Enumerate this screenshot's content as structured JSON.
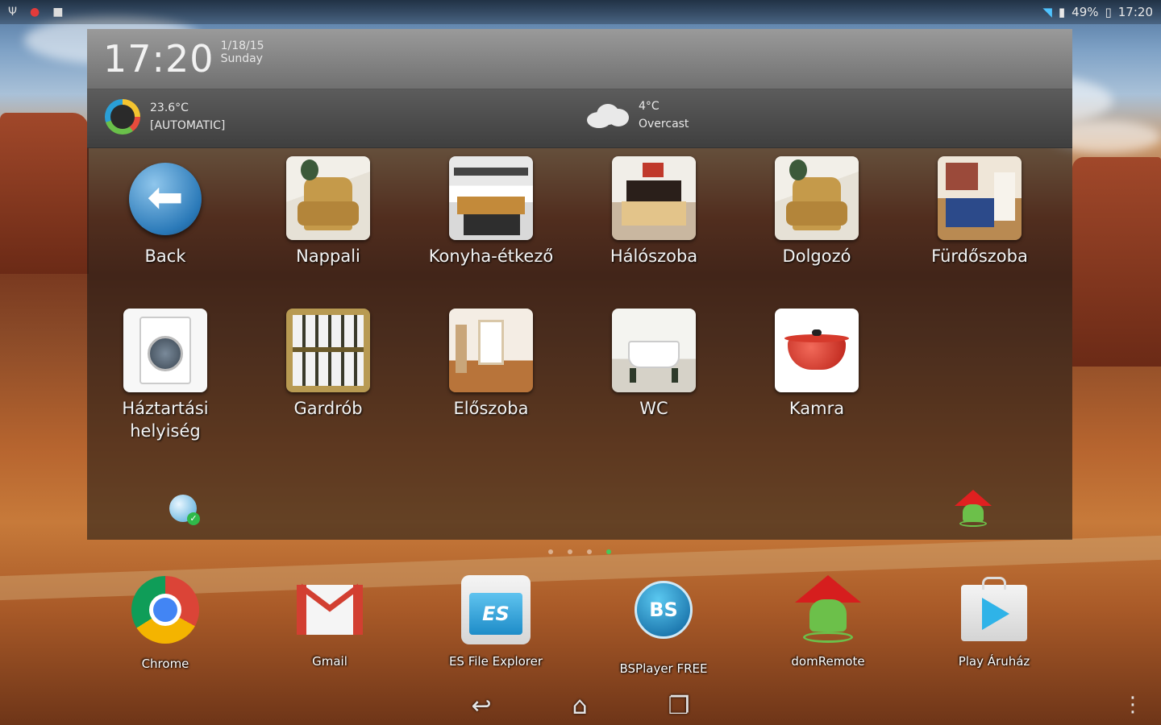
{
  "status_bar": {
    "left_icons": [
      "usb-icon",
      "notification-icon",
      "media-icon"
    ],
    "battery": "49%",
    "time": "17:20"
  },
  "widget": {
    "clock": "17:20",
    "date": "1/18/15",
    "day": "Sunday",
    "thermostat": {
      "temperature": "23.6°C",
      "mode": "[AUTOMATIC]"
    },
    "weather": {
      "temperature": "4°C",
      "condition": "Overcast"
    }
  },
  "rooms": [
    {
      "label": "Back",
      "icon": "back-arrow-icon"
    },
    {
      "label": "Nappali",
      "icon": "armchair-icon"
    },
    {
      "label": "Konyha-étkező",
      "icon": "kitchen-icon"
    },
    {
      "label": "Hálószoba",
      "icon": "bedroom-icon"
    },
    {
      "label": "Dolgozó",
      "icon": "armchair-icon"
    },
    {
      "label": "Fürdőszoba",
      "icon": "bathroom-icon"
    },
    {
      "label": "Háztartási helyiség",
      "icon": "washing-machine-icon"
    },
    {
      "label": "Gardrób",
      "icon": "wardrobe-icon"
    },
    {
      "label": "Előszoba",
      "icon": "hallway-icon"
    },
    {
      "label": "WC",
      "icon": "toilet-icon"
    },
    {
      "label": "Kamra",
      "icon": "pot-icon"
    }
  ],
  "page_dots": {
    "count": 4,
    "active": 3
  },
  "dock": [
    {
      "label": "Chrome",
      "icon": "chrome-icon"
    },
    {
      "label": "Gmail",
      "icon": "gmail-icon"
    },
    {
      "label": "ES File Explorer",
      "icon": "es-file-explorer-icon"
    },
    {
      "label": "BSPlayer FREE",
      "icon": "bsplayer-icon"
    },
    {
      "label": "domRemote",
      "icon": "domremote-icon"
    },
    {
      "label": "Play Áruház",
      "icon": "play-store-icon"
    }
  ],
  "navigation": [
    "back-icon",
    "home-icon",
    "recents-icon",
    "overflow-menu-icon"
  ]
}
